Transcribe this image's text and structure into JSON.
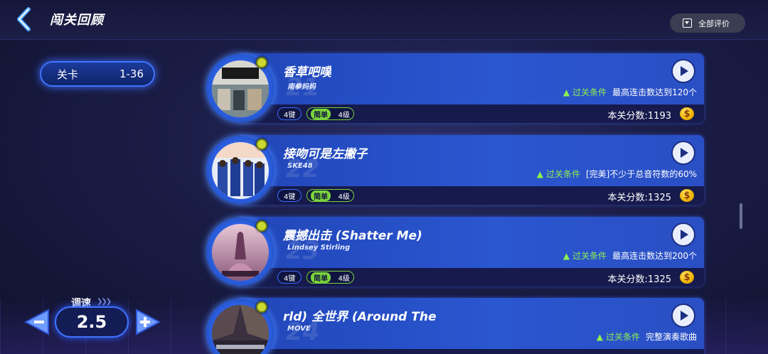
{
  "header": {
    "title": "闯关回顾",
    "all_eval_label": "全部评价"
  },
  "level": {
    "label": "关卡",
    "range": "1-36"
  },
  "speed": {
    "label": "调速",
    "value": "2.5"
  },
  "songs": [
    {
      "num": "21",
      "title": "香草吧噗",
      "artist": "南拳妈妈",
      "cond_tag": "过关条件",
      "condition": "最高连击数达到120个",
      "keys": "4键",
      "difficulty": "简单",
      "level": "4级",
      "score": "本关分数:1193"
    },
    {
      "num": "22",
      "title": "接吻可是左撇子",
      "artist": "SKE48",
      "cond_tag": "过关条件",
      "condition": "[完美]不少于总音符数的60%",
      "keys": "4键",
      "difficulty": "简单",
      "level": "4级",
      "score": "本关分数:1325"
    },
    {
      "num": "23",
      "title": "震撼出击 (Shatter Me)",
      "artist": "Lindsey Stirling",
      "cond_tag": "过关条件",
      "condition": "最高连击数达到200个",
      "keys": "4键",
      "difficulty": "简单",
      "level": "4级",
      "score": "本关分数:1325"
    },
    {
      "num": "24",
      "title": "rld)  全世界 (Around The",
      "artist": "MOVE",
      "cond_tag": "过关条件",
      "condition": "完整演奏歌曲",
      "keys": "",
      "difficulty": "",
      "level": "",
      "score": ""
    }
  ],
  "colors": {
    "accent": "#3f74ff",
    "card": "#2a56d0",
    "condition": "#8cf052",
    "coin": "#f0b400"
  },
  "icons": {
    "back": "chevron-left-icon",
    "play": "play-icon",
    "warn": "warning-icon",
    "coin": "coin-icon",
    "medal": "medal-icon"
  }
}
